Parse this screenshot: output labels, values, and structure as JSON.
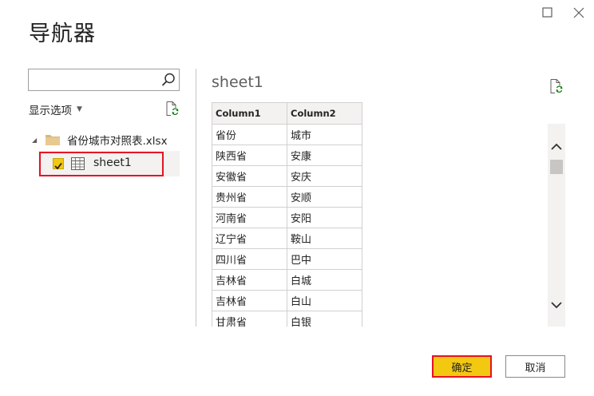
{
  "window": {
    "title": "导航器",
    "maximize_icon": "maximize-icon",
    "close_icon": "close-icon"
  },
  "left_panel": {
    "search": {
      "value": "",
      "placeholder": ""
    },
    "display_options_label": "显示选项",
    "tree": {
      "file_name": "省份城市对照表.xlsx",
      "items": [
        {
          "label": "sheet1",
          "checked": true
        }
      ]
    }
  },
  "preview": {
    "title": "sheet1",
    "columns": [
      "Column1",
      "Column2"
    ],
    "rows": [
      [
        "省份",
        "城市"
      ],
      [
        "陕西省",
        "安康"
      ],
      [
        "安徽省",
        "安庆"
      ],
      [
        "贵州省",
        "安顺"
      ],
      [
        "河南省",
        "安阳"
      ],
      [
        "辽宁省",
        "鞍山"
      ],
      [
        "四川省",
        "巴中"
      ],
      [
        "吉林省",
        "白城"
      ],
      [
        "吉林省",
        "白山"
      ],
      [
        "甘肃省",
        "白银"
      ]
    ]
  },
  "footer": {
    "ok_label": "确定",
    "cancel_label": "取消"
  },
  "colors": {
    "accent": "#f2c811",
    "highlight_border": "#e81123"
  }
}
